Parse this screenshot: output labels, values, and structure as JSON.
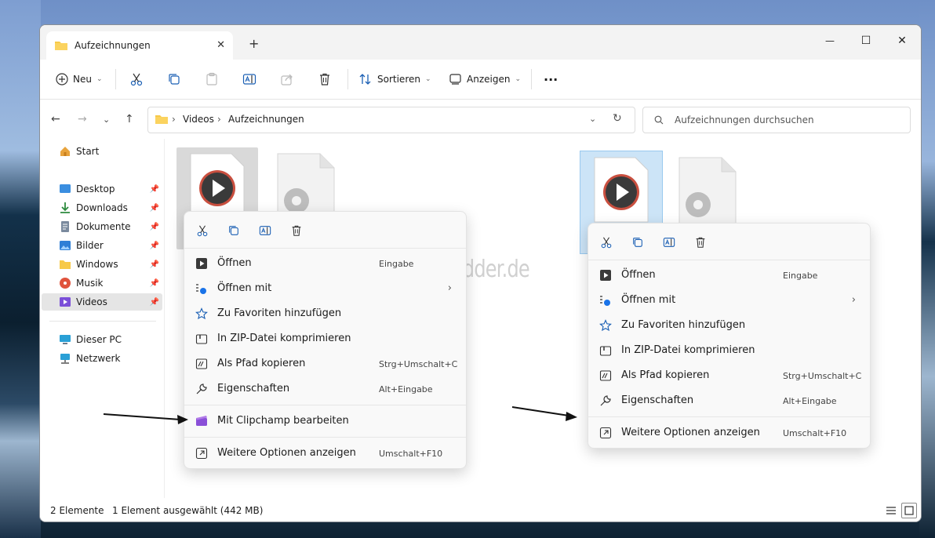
{
  "tab": {
    "title": "Aufzeichnungen",
    "close": "✕",
    "add": "+"
  },
  "window_buttons": {
    "minimize": "—",
    "maximize": "☐",
    "close": "✕"
  },
  "toolbar": {
    "new_label": "Neu",
    "sort_label": "Sortieren",
    "view_label": "Anzeigen",
    "more_label": "···"
  },
  "address": {
    "crumbs": [
      "Videos",
      "Aufzeichnungen"
    ],
    "search_placeholder": "Aufzeichnungen durchsuchen"
  },
  "sidebar": {
    "items": [
      {
        "label": "Start"
      },
      {
        "label": "Desktop"
      },
      {
        "label": "Downloads"
      },
      {
        "label": "Dokumente"
      },
      {
        "label": "Bilder"
      },
      {
        "label": "Windows"
      },
      {
        "label": "Musik"
      },
      {
        "label": "Videos"
      },
      {
        "label": "Dieser PC"
      },
      {
        "label": "Netzwerk"
      }
    ]
  },
  "status": {
    "count": "2 Elemente",
    "selection": "1 Element ausgewählt (442 MB)"
  },
  "watermark": "Deskmodder.de",
  "menu_left": {
    "open": "Öffnen",
    "open_sc": "Eingabe",
    "open_with": "Öffnen mit",
    "fav": "Zu Favoriten hinzufügen",
    "zip": "In ZIP-Datei komprimieren",
    "copypath": "Als Pfad kopieren",
    "copypath_sc": "Strg+Umschalt+C",
    "props": "Eigenschaften",
    "props_sc": "Alt+Eingabe",
    "clipchamp": "Mit Clipchamp bearbeiten",
    "more": "Weitere Optionen anzeigen",
    "more_sc": "Umschalt+F10"
  },
  "menu_right": {
    "open": "Öffnen",
    "open_sc": "Eingabe",
    "open_with": "Öffnen mit",
    "fav": "Zu Favoriten hinzufügen",
    "zip": "In ZIP-Datei komprimieren",
    "copypath": "Als Pfad kopieren",
    "copypath_sc": "Strg+Umschalt+C",
    "props": "Eigenschaften",
    "props_sc": "Alt+Eingabe",
    "more": "Weitere Optionen anzeigen",
    "more_sc": "Umschalt+F10"
  },
  "colors": {
    "accent": "#0067c0",
    "selection": "#cce4f7",
    "folder": "#f7c948"
  }
}
